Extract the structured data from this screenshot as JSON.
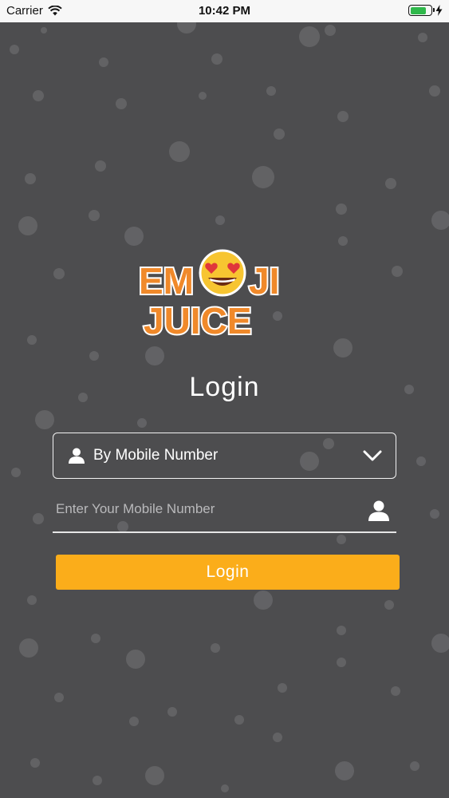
{
  "status_bar": {
    "carrier": "Carrier",
    "time": "10:42 PM",
    "battery_color": "#2fb84b"
  },
  "logo": {
    "line1_left": "EM",
    "line1_right": "JI",
    "line2": "JUICE",
    "emoji_icon": "heart-eyes-emoji-icon",
    "colors": {
      "text": "#f0892a",
      "outline": "#ffffff",
      "emoji": "#f7c531"
    }
  },
  "login": {
    "title": "Login",
    "method_select": {
      "selected": "By Mobile Number",
      "icon": "user-icon",
      "dropdown_icon": "chevron-down-icon"
    },
    "mobile_input": {
      "value": "",
      "placeholder": "Enter Your Mobile Number",
      "icon": "user-icon"
    },
    "button_label": "Login",
    "button_color": "#fbad1a"
  },
  "background_color": "#4d4d4f"
}
